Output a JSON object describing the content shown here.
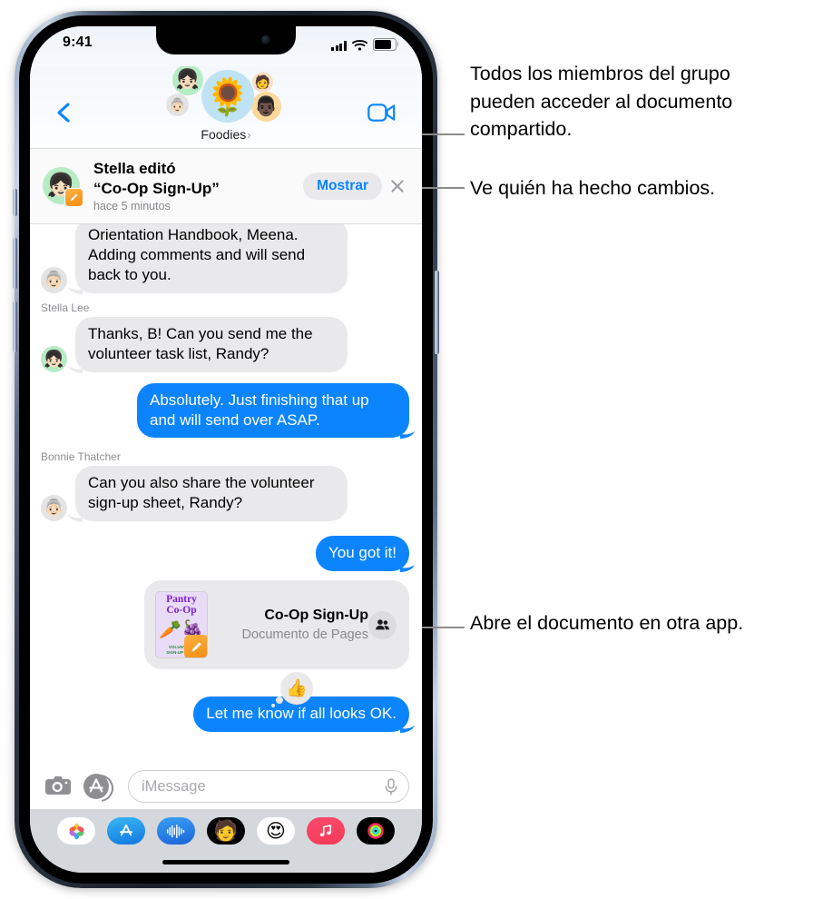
{
  "status_bar": {
    "time": "9:41",
    "cellular_icon": "cellular-bars-icon",
    "wifi_icon": "wifi-icon",
    "battery_icon": "battery-icon"
  },
  "nav": {
    "back_icon": "back-chevron-icon",
    "facetime_icon": "video-camera-icon",
    "group_name": "Foodies",
    "group_chevron": "›",
    "avatars": [
      {
        "name": "group-avatar-main",
        "glyph": "🌻",
        "bg": "#bfe3f5"
      },
      {
        "name": "group-avatar-stella",
        "glyph": "👧🏻",
        "bg": "#b6ebc3"
      },
      {
        "name": "group-avatar-bonnie",
        "glyph": "👵🏻",
        "bg": "#e3e3e3"
      },
      {
        "name": "group-avatar-member-3",
        "glyph": "🧑",
        "bg": "#fbe0c9"
      },
      {
        "name": "group-avatar-member-4",
        "glyph": "👨🏿",
        "bg": "#fbd99b"
      }
    ]
  },
  "banner": {
    "avatar_glyph": "👧🏻",
    "badge_icon": "pages-app-icon",
    "line1": "Stella editó",
    "line2": "“Co-Op Sign-Up”",
    "timestamp": "hace 5 minutos",
    "show_label": "Mostrar",
    "close_icon": "close-icon"
  },
  "messages": [
    {
      "id": "msg-bonnie-1",
      "side": "in",
      "sender": null,
      "avatar_glyph": "👵🏻",
      "avatar_bg": "av-gray",
      "text": "Orientation Handbook, Meena. Adding comments and will send back to you.",
      "clipped": true
    },
    {
      "id": "msg-stella-1",
      "side": "in",
      "sender": "Stella Lee",
      "avatar_glyph": "👧🏻",
      "avatar_bg": "av-green",
      "text": "Thanks, B! Can you send me the volunteer task list, Randy?"
    },
    {
      "id": "msg-me-1",
      "side": "out",
      "sender": null,
      "text": "Absolutely. Just finishing that up and will send over ASAP."
    },
    {
      "id": "msg-bonnie-2",
      "side": "in",
      "sender": "Bonnie Thatcher",
      "avatar_glyph": "👵🏻",
      "avatar_bg": "av-gray",
      "text": "Can you also share the volunteer sign-up sheet, Randy?"
    },
    {
      "id": "msg-me-2",
      "side": "out",
      "sender": null,
      "text": "You got it!"
    },
    {
      "id": "msg-me-3",
      "side": "out",
      "sender": null,
      "text": "Let me know if all looks OK.",
      "tapback": "👍"
    }
  ],
  "document_card": {
    "title": "Co-Op Sign-Up",
    "subtitle": "Documento de Pages",
    "thumbnail": {
      "title_line1": "Pantry",
      "title_line2": "Co-Op",
      "art_glyph": "🥕🍇",
      "footer_line1": "VOLUNTEER",
      "footer_line2": "SIGN-UP FORM",
      "badge_icon": "pages-app-icon"
    },
    "participants_icon": "people-icon"
  },
  "input_bar": {
    "camera_icon": "camera-icon",
    "appstore_icon": "app-store-icon",
    "placeholder": "iMessage",
    "value": "",
    "mic_icon": "microphone-icon"
  },
  "app_drawer": {
    "apps": [
      {
        "name": "app-drawer-photos",
        "icon": "photos-icon"
      },
      {
        "name": "app-drawer-app-store",
        "icon": "app-store-icon"
      },
      {
        "name": "app-drawer-audio-message",
        "icon": "audio-waveform-icon"
      },
      {
        "name": "app-drawer-memoji",
        "icon": "memoji-icon"
      },
      {
        "name": "app-drawer-memoji-stickers",
        "icon": "memoji-stickers-icon"
      },
      {
        "name": "app-drawer-music",
        "icon": "music-icon"
      },
      {
        "name": "app-drawer-fitness",
        "icon": "activity-rings-icon"
      }
    ]
  },
  "callouts": [
    {
      "id": "callout-shared-doc-access",
      "text": "Todos los miembros del grupo pueden acceder al documento compartido."
    },
    {
      "id": "callout-see-who-made-changes",
      "text": "Ve quién ha hecho cambios."
    },
    {
      "id": "callout-open-in-another-app",
      "text": "Abre el documento en otra app."
    }
  ],
  "colors": {
    "imessage_blue": "#0b84fe",
    "bubble_gray": "#e9e9eb",
    "accent_link": "#0a84ff",
    "drawer_bg": "#d4d7db"
  }
}
